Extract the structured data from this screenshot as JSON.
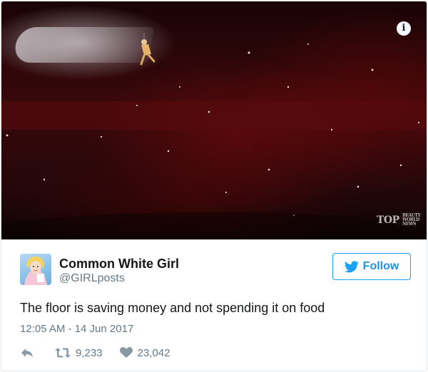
{
  "media": {
    "icon": "info-icon",
    "info_glyph": "i",
    "watermark": "TOP",
    "watermark_small": "BEAUTY WORLD NEWS"
  },
  "author": {
    "name": "Common White Girl",
    "handle": "@GIRLposts",
    "avatar": "cartoon-princess-avatar"
  },
  "follow": {
    "label": "Follow",
    "icon": "twitter-bird-icon",
    "color": "#1da1f2"
  },
  "tweet": {
    "text": "The floor is saving money and not spending it on food",
    "timestamp": "12:05 AM - 14 Jun 2017"
  },
  "actions": {
    "reply_icon": "reply-icon",
    "retweet_icon": "retweet-icon",
    "retweets": "9,233",
    "like_icon": "heart-icon",
    "likes": "23,042"
  },
  "colors": {
    "text": "#14171a",
    "secondary": "#657786",
    "accent": "#1b95e0"
  }
}
